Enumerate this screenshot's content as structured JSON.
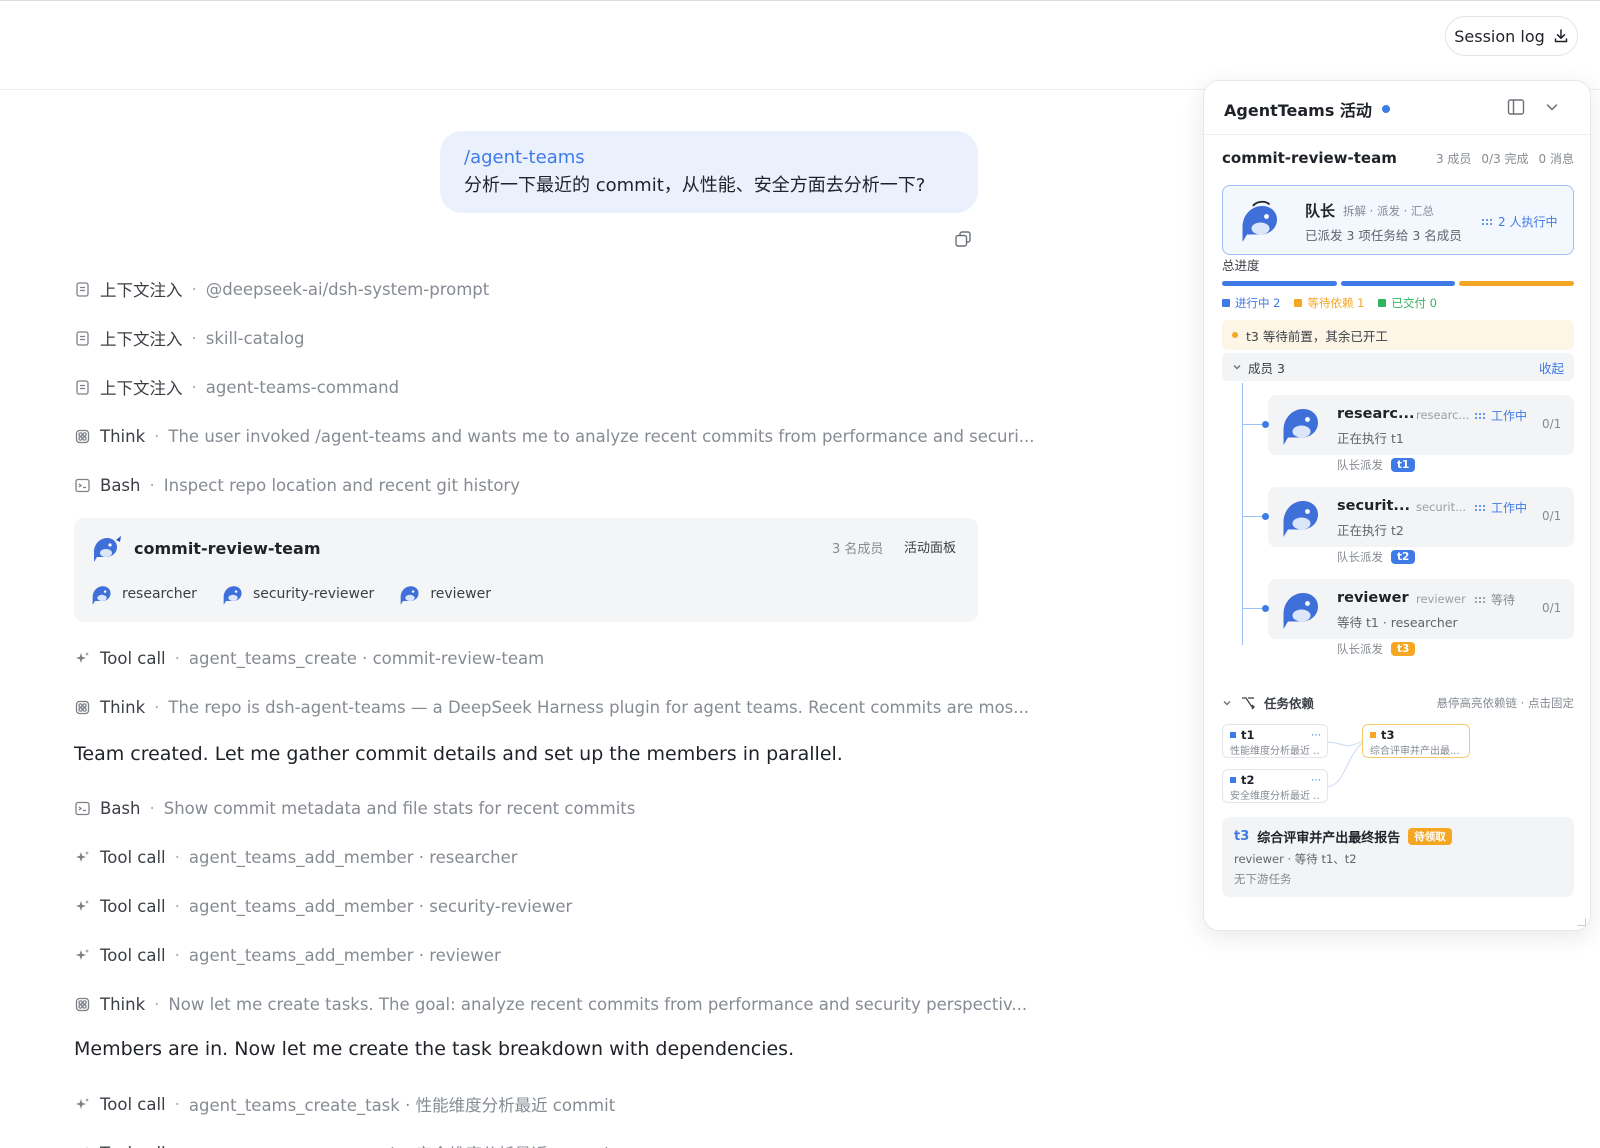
{
  "header": {
    "session_log_label": "Session log"
  },
  "user_message": {
    "command": "/agent-teams",
    "text": "分析一下最近的 commit，从性能、安全方面去分析一下?"
  },
  "steps_top": [
    {
      "icon": "doc-icon",
      "kind": "上下文注入",
      "detail": "@deepseek-ai/dsh-system-prompt"
    },
    {
      "icon": "doc-icon",
      "kind": "上下文注入",
      "detail": "skill-catalog"
    },
    {
      "icon": "doc-icon",
      "kind": "上下文注入",
      "detail": "agent-teams-command"
    },
    {
      "icon": "think-icon",
      "kind": "Think",
      "detail": "The user invoked /agent-teams and wants me to analyze recent commits from performance and securi..."
    },
    {
      "icon": "terminal-icon",
      "kind": "Bash",
      "detail": "Inspect repo location and recent git history"
    }
  ],
  "team_card": {
    "name": "commit-review-team",
    "member_count": "3 名成员",
    "board_label": "活动面板",
    "members": [
      "researcher",
      "security-reviewer",
      "reviewer"
    ]
  },
  "steps_mid": [
    {
      "icon": "sparkle-icon",
      "kind": "Tool call",
      "detail": "agent_teams_create · commit-review-team"
    },
    {
      "icon": "think-icon",
      "kind": "Think",
      "detail": "The repo is dsh-agent-teams — a DeepSeek Harness plugin for agent teams. Recent commits are mos..."
    }
  ],
  "para1": "Team created. Let me gather commit details and set up the members in parallel.",
  "steps_bottom": [
    {
      "icon": "terminal-icon",
      "kind": "Bash",
      "detail": "Show commit metadata and file stats for recent commits"
    },
    {
      "icon": "sparkle-icon",
      "kind": "Tool call",
      "detail": "agent_teams_add_member · researcher"
    },
    {
      "icon": "sparkle-icon",
      "kind": "Tool call",
      "detail": "agent_teams_add_member · security-reviewer"
    },
    {
      "icon": "sparkle-icon",
      "kind": "Tool call",
      "detail": "agent_teams_add_member · reviewer"
    },
    {
      "icon": "think-icon",
      "kind": "Think",
      "detail": "Now let me create tasks. The goal: analyze recent commits from performance and security perspectiv..."
    }
  ],
  "para2": "Members are in. Now let me create the task breakdown with dependencies.",
  "steps_end": [
    {
      "icon": "sparkle-icon",
      "kind": "Tool call",
      "detail": "agent_teams_create_task · 性能维度分析最近 commit"
    },
    {
      "icon": "sparkle-icon",
      "kind": "Tool call",
      "detail": "agent_teams_create_task · 安全维度分析最近 commit"
    }
  ],
  "panel": {
    "title": "AgentTeams 活动",
    "team_name": "commit-review-team",
    "stats": [
      "3 成员",
      "0/3 完成",
      "0 消息"
    ],
    "leader": {
      "name": "队长",
      "tags": "拆解 · 派发 · 汇总",
      "sub": "已派发 3 项任务给 3 名成员",
      "status": "2 人执行中"
    },
    "progress_label": "总进度",
    "progress": {
      "in_progress": 2,
      "waiting": 1,
      "delivered": 0,
      "total": 3
    },
    "legend": [
      "进行中 2",
      "等待依赖 1",
      "已交付 0"
    ],
    "colors": {
      "in_progress": "#3f7be6",
      "waiting": "#f5a623",
      "delivered": "#2fb55d"
    },
    "alert": "t3 等待前置，其余已开工",
    "members_label": "成员 3",
    "collapse_label": "收起",
    "members": [
      {
        "name": "researc...",
        "role": "researc...",
        "task": "正在执行 t1",
        "status": "工作中",
        "count": "0/1",
        "assign": "队长派发",
        "tag": "t1",
        "tag_color": "#3f7be6",
        "status_color": "#3f7be6"
      },
      {
        "name": "securit...",
        "role": "securit...",
        "task": "正在执行 t2",
        "status": "工作中",
        "count": "0/1",
        "assign": "队长派发",
        "tag": "t2",
        "tag_color": "#3f7be6",
        "status_color": "#3f7be6"
      },
      {
        "name": "reviewer",
        "role": "reviewer",
        "task": "等待 t1 · researcher",
        "status": "等待",
        "count": "0/1",
        "assign": "队长派发",
        "tag": "t3",
        "tag_color": "#f5a623",
        "status_color": "#868b93"
      }
    ],
    "deps_label": "任务依赖",
    "deps_hint": "悬停高亮依赖链 · 点击固定",
    "dep_nodes": [
      {
        "id": "t1",
        "desc": "性能维度分析最近 ..."
      },
      {
        "id": "t2",
        "desc": "安全维度分析最近 ..."
      },
      {
        "id": "t3",
        "desc": "综合评审并产出最..."
      }
    ],
    "task_detail": {
      "id": "t3",
      "title": "综合评审并产出最终报告",
      "badge": "待领取",
      "sub": "reviewer · 等待 t1、t2",
      "downstream": "无下游任务"
    }
  }
}
